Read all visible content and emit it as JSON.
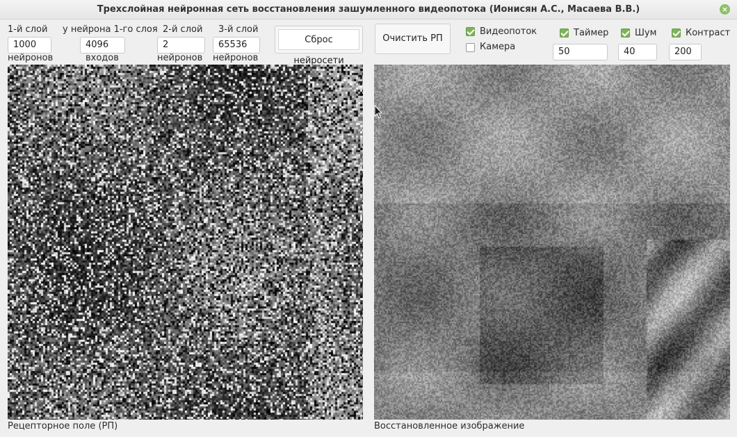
{
  "window": {
    "title": "Трехслойная нейронная сеть восстановления зашумленного видеопотока (Ионисян А.С., Масаева В.В.)",
    "close_symbol": "×"
  },
  "params": {
    "layer1": {
      "label": "1-й слой",
      "value": "1000",
      "sublabel": "нейронов"
    },
    "inputs": {
      "label": "у нейрона 1-го слоя",
      "value": "4096",
      "sublabel": "входов"
    },
    "layer2": {
      "label": "2-й слой",
      "value": "2",
      "sublabel": "нейронов"
    },
    "layer3": {
      "label": "3-й слой",
      "value": "65536",
      "sublabel": "нейронов"
    }
  },
  "buttons": {
    "reset": "Сброс нейросети",
    "clear": "Очистить РП"
  },
  "options": {
    "video": {
      "label": "Видеопоток",
      "checked": true
    },
    "camera": {
      "label": "Камера",
      "checked": false
    },
    "timer": {
      "label": "Таймер",
      "checked": true,
      "value": "50"
    },
    "noise": {
      "label": "Шум",
      "checked": true,
      "value": "40"
    },
    "contrast": {
      "label": "Контраст",
      "checked": true,
      "value": "200"
    }
  },
  "panels": {
    "receptor_caption": "Рецепторное поле (РП)",
    "restored_caption": "Восстановленное изображение"
  }
}
